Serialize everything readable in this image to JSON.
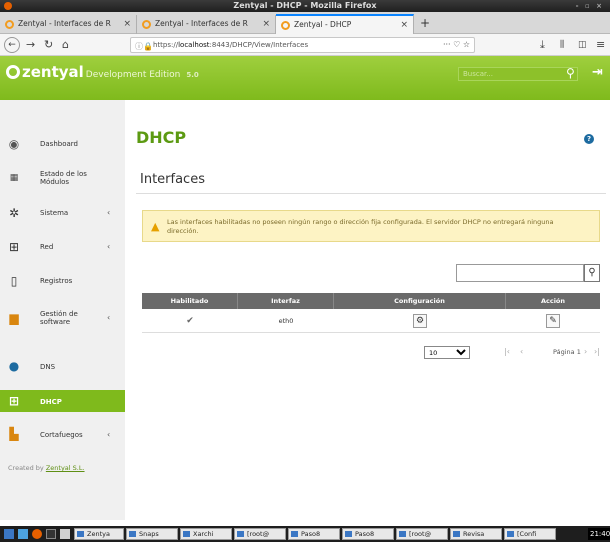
{
  "window": {
    "title": "Zentyal - DHCP - Mozilla Firefox",
    "controls": "- ▫ ×"
  },
  "tabs": [
    {
      "label": "Zentyal - Interfaces de R"
    },
    {
      "label": "Zentyal - Interfaces de R"
    },
    {
      "label": "Zentyal - DHCP"
    }
  ],
  "nav": {
    "url_prefix": "https://",
    "url_host": "localhost",
    "url_rest": ":8443/DHCP/View/Interfaces",
    "tools": "··· ♡ ☆"
  },
  "header": {
    "logo": "zentyal",
    "edition": "Development Edition",
    "version": "5.0",
    "search_placeholder": "Buscar..."
  },
  "sidebar": {
    "items": [
      {
        "label": "Dashboard"
      },
      {
        "label": "Estado de los",
        "label2": "Módulos"
      },
      {
        "label": "Sistema"
      },
      {
        "label": "Red"
      },
      {
        "label": "Registros"
      },
      {
        "label": "Gestión de",
        "label2": "software"
      },
      {
        "label": "DNS"
      },
      {
        "label": "DHCP"
      },
      {
        "label": "Cortafuegos"
      }
    ],
    "created_prefix": "Created by ",
    "created_link": "Zentyal S.L."
  },
  "main": {
    "title": "DHCP",
    "section": "Interfaces",
    "warning": "Las interfaces habilitadas no poseen ningún rango o dirección fija configurada. El servidor DHCP no entregará ninguna dirección.",
    "table": {
      "headers": [
        "Habilitado",
        "Interfaz",
        "Configuración",
        "Acción"
      ],
      "rows": [
        {
          "enabled": "✔",
          "interface": "eth0"
        }
      ]
    },
    "pager": {
      "page_size": "10",
      "page_label": "Página 1"
    }
  },
  "taskbar": {
    "items": [
      "Zentya",
      "Snaps",
      "Xarchi",
      "[root@",
      "Paso8",
      "Paso8",
      "[root@",
      "Revisa",
      "[Confi"
    ],
    "clock": "21:40"
  },
  "colors": {
    "accent": "#7fba1c",
    "title_green": "#5c9a12",
    "warning_bg": "#fdf3c4"
  }
}
